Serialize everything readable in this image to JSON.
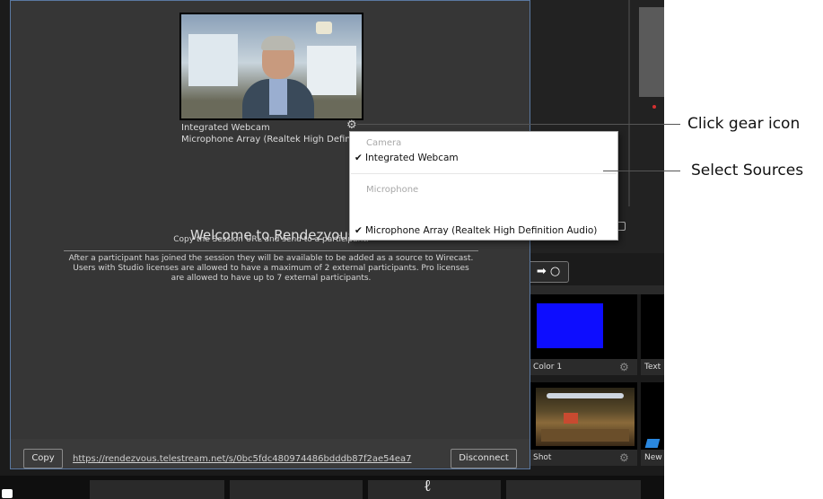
{
  "dialog": {
    "source_video": "Integrated Webcam",
    "source_audio": "Microphone Array (Realtek High Definitio",
    "welcome": "Welcome to Rendezvous",
    "instruction": "Copy the Session URL and send to a participant.",
    "info_line1": "After a participant has joined the session they will be available to be added as a source to Wirecast.",
    "info_line2": "Users with Studio licenses are allowed to have a maximum of 2 external participants. Pro licenses",
    "info_line3": "are allowed to have up to 7 external participants.",
    "copy_label": "Copy",
    "url": "https://rendezvous.telestream.net/s/0bc5fdc480974486bdddb87f2ae54ea7",
    "disconnect_label": "Disconnect"
  },
  "menu": {
    "camera_header": "Camera",
    "camera_item": "Integrated Webcam",
    "mic_header": "Microphone",
    "mic_item": "Microphone Array (Realtek High Definition Audio)",
    "check": "✔"
  },
  "callouts": {
    "gear": "Click gear icon",
    "sources": "Select Sources"
  },
  "background": {
    "shot1_label": "Color 1",
    "shot2_label": "Text",
    "shot3_label": "Shot",
    "shot4_label": "New",
    "arrow_label": "➡ ○"
  },
  "colors": {
    "blue_shot": "#0d0dff",
    "dialog_bg": "#363636",
    "menu_bg": "#ffffff"
  }
}
